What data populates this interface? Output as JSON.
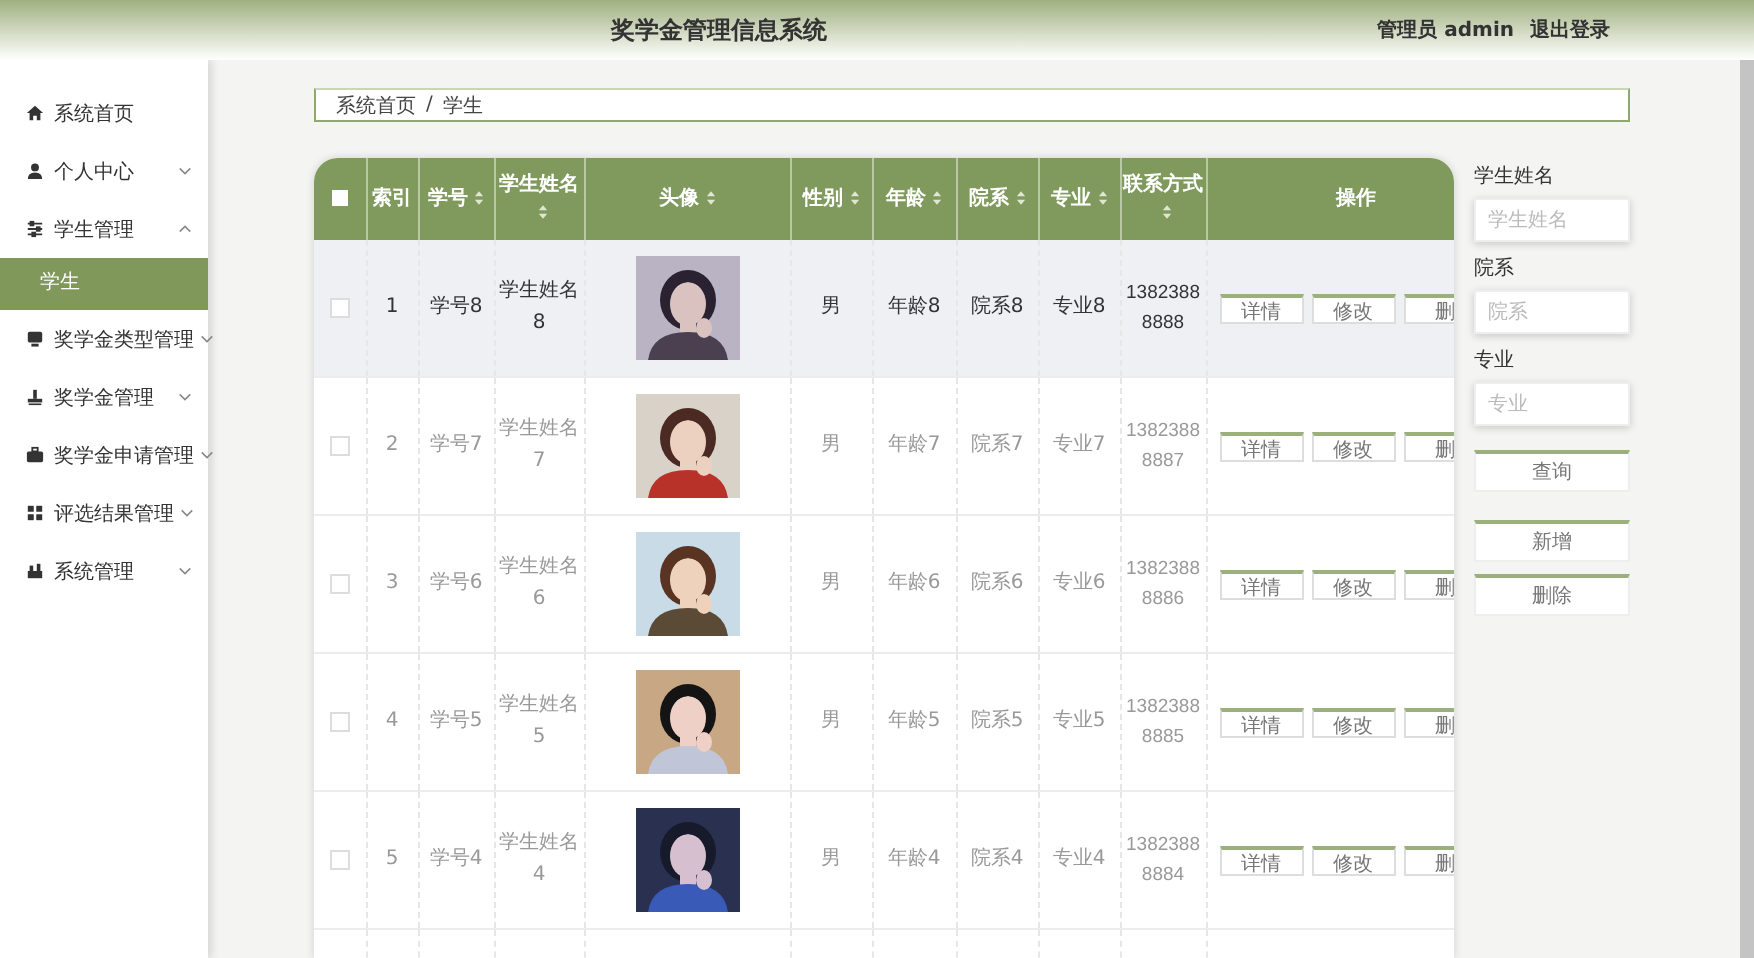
{
  "header": {
    "title": "奖学金管理信息系统",
    "user": "管理员 admin",
    "logout": "退出登录"
  },
  "sidebar": {
    "items": [
      {
        "label": "系统首页"
      },
      {
        "label": "个人中心",
        "expanded": false
      },
      {
        "label": "学生管理",
        "expanded": true,
        "children": [
          {
            "label": "学生",
            "selected": true
          }
        ]
      },
      {
        "label": "奖学金类型管理",
        "expanded": false
      },
      {
        "label": "奖学金管理",
        "expanded": false
      },
      {
        "label": "奖学金申请管理",
        "expanded": false
      },
      {
        "label": "评选结果管理",
        "expanded": false
      },
      {
        "label": "系统管理",
        "expanded": false
      }
    ]
  },
  "breadcrumb": {
    "items": [
      "系统首页",
      "学生"
    ],
    "separator": "/"
  },
  "table": {
    "columns": [
      {
        "kind": "checkbox",
        "checked": false
      },
      {
        "kind": "text",
        "label": "索引",
        "sortable": false
      },
      {
        "kind": "text",
        "label": "学号",
        "sortable": true
      },
      {
        "kind": "text",
        "label": "学生姓名",
        "sortable": true
      },
      {
        "kind": "text",
        "label": "头像",
        "sortable": true
      },
      {
        "kind": "text",
        "label": "性别",
        "sortable": true
      },
      {
        "kind": "text",
        "label": "年龄",
        "sortable": true
      },
      {
        "kind": "text",
        "label": "院系",
        "sortable": true
      },
      {
        "kind": "text",
        "label": "专业",
        "sortable": true
      },
      {
        "kind": "text",
        "label": "联系方式",
        "sortable": true
      },
      {
        "kind": "text",
        "label": "操作",
        "sortable": false
      }
    ],
    "rows": [
      {
        "highlighted": true,
        "checked": false,
        "index": "1",
        "student_no": "学号8",
        "name": "学生姓名8",
        "gender": "男",
        "age": "年龄8",
        "department": "院系8",
        "major": "专业8",
        "phone": "13823888888",
        "actions": [
          "详情",
          "修改",
          "删"
        ]
      },
      {
        "highlighted": false,
        "checked": false,
        "index": "2",
        "student_no": "学号7",
        "name": "学生姓名7",
        "gender": "男",
        "age": "年龄7",
        "department": "院系7",
        "major": "专业7",
        "phone": "13823888887",
        "actions": [
          "详情",
          "修改",
          "删"
        ]
      },
      {
        "highlighted": false,
        "checked": false,
        "index": "3",
        "student_no": "学号6",
        "name": "学生姓名6",
        "gender": "男",
        "age": "年龄6",
        "department": "院系6",
        "major": "专业6",
        "phone": "13823888886",
        "actions": [
          "详情",
          "修改",
          "删"
        ]
      },
      {
        "highlighted": false,
        "checked": false,
        "index": "4",
        "student_no": "学号5",
        "name": "学生姓名5",
        "gender": "男",
        "age": "年龄5",
        "department": "院系5",
        "major": "专业5",
        "phone": "13823888885",
        "actions": [
          "详情",
          "修改",
          "删"
        ]
      },
      {
        "highlighted": false,
        "checked": false,
        "index": "5",
        "student_no": "学号4",
        "name": "学生姓名4",
        "gender": "男",
        "age": "年龄4",
        "department": "院系4",
        "major": "专业4",
        "phone": "13823888884",
        "actions": [
          "详情",
          "修改",
          "删"
        ]
      }
    ]
  },
  "search_panel": {
    "filters": [
      {
        "label": "学生姓名",
        "placeholder": "学生姓名"
      },
      {
        "label": "院系",
        "placeholder": "院系"
      },
      {
        "label": "专业",
        "placeholder": "专业"
      }
    ],
    "query_button": "查询",
    "buttons": [
      "新增",
      "删除"
    ]
  }
}
